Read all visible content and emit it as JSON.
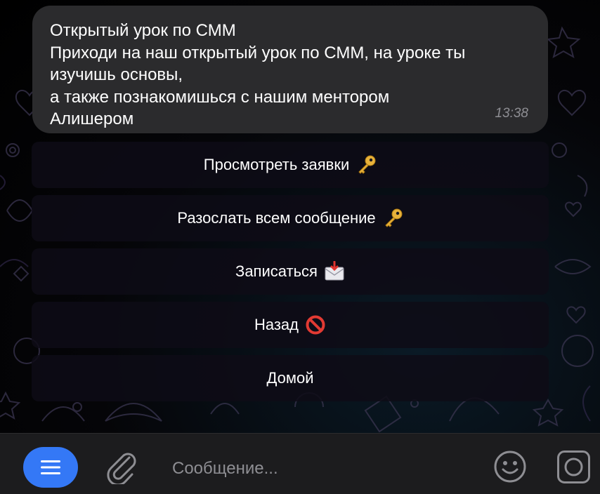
{
  "message": {
    "lines": [
      "Открытый урок по СММ",
      "Приходи на наш открытый урок по СММ, на уроке ты",
      "изучишь основы,",
      "а также познакомишься с нашим ментором",
      "Алишером"
    ],
    "time": "13:38"
  },
  "keyboard": [
    {
      "label": "Просмотреть заявки",
      "icon": "key-icon"
    },
    {
      "label": "Разослать всем сообщение",
      "icon": "key-icon"
    },
    {
      "label": "Записаться",
      "icon": "envelope-icon"
    },
    {
      "label": "Назад",
      "icon": "prohibited-icon"
    },
    {
      "label": "Домой",
      "icon": null
    }
  ],
  "composer": {
    "placeholder": "Сообщение..."
  },
  "colors": {
    "accent": "#3478f6",
    "bubble": "#2b2b2d",
    "bar": "#1c1c1e"
  }
}
